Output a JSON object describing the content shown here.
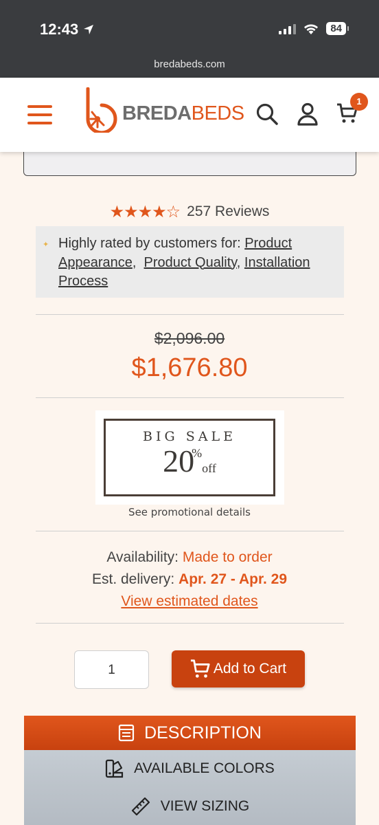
{
  "status_bar": {
    "time": "12:43",
    "battery": "84",
    "url": "bredabeds.com"
  },
  "header": {
    "logo_brand_bold": "BREDA",
    "logo_brand_light": "BEDS",
    "cart_count": "1"
  },
  "rating": {
    "stars": "★★★★☆",
    "stars_value": 4.5,
    "reviews": "257 Reviews"
  },
  "highlights": {
    "intro": "Highly rated by customers for:",
    "tags": [
      "Product Appearance",
      "Product Quality",
      "Installation Process"
    ]
  },
  "price": {
    "original": "$2,096.00",
    "sale": "$1,676.80"
  },
  "promo": {
    "title": "BIG SALE",
    "number": "20",
    "percent": "%",
    "off": "off",
    "link": "See promotional details"
  },
  "availability": {
    "label": "Availability:",
    "value": "Made to order",
    "delivery_label": "Est. delivery:",
    "delivery_value": "Apr. 27 - Apr. 29",
    "view_dates": "View estimated dates"
  },
  "purchase": {
    "quantity": "1",
    "add_to_cart": "Add to Cart"
  },
  "tabs": {
    "description": "DESCRIPTION",
    "colors": "AVAILABLE COLORS",
    "sizing": "VIEW SIZING"
  },
  "colors": {
    "accent": "#e0561c",
    "button": "#c8420f",
    "status_bar": "#3a3c3f"
  }
}
